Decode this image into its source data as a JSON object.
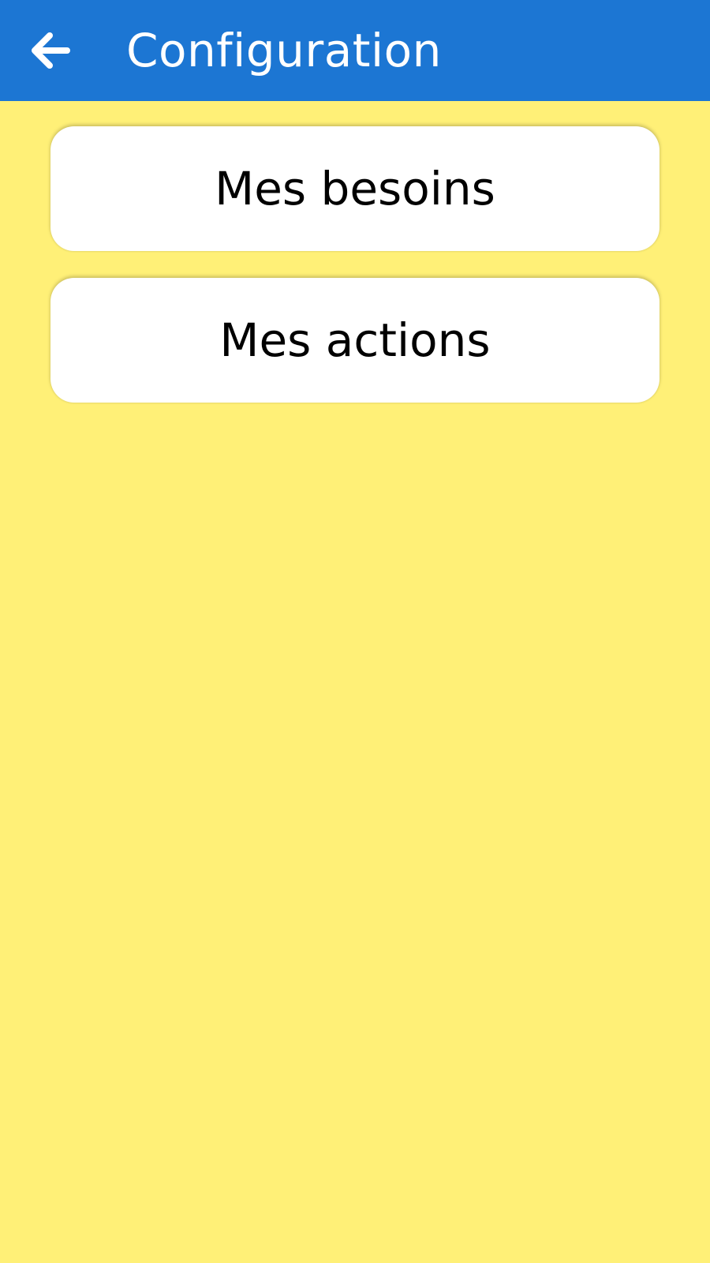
{
  "app_bar": {
    "title": "Configuration",
    "back_icon": "arrow-left-icon",
    "background_color": "#1C76D3",
    "text_color": "#FFFFFF"
  },
  "main": {
    "background_color": "#FFF077",
    "menu_items": [
      {
        "label": "Mes besoins"
      },
      {
        "label": "Mes actions"
      }
    ]
  }
}
